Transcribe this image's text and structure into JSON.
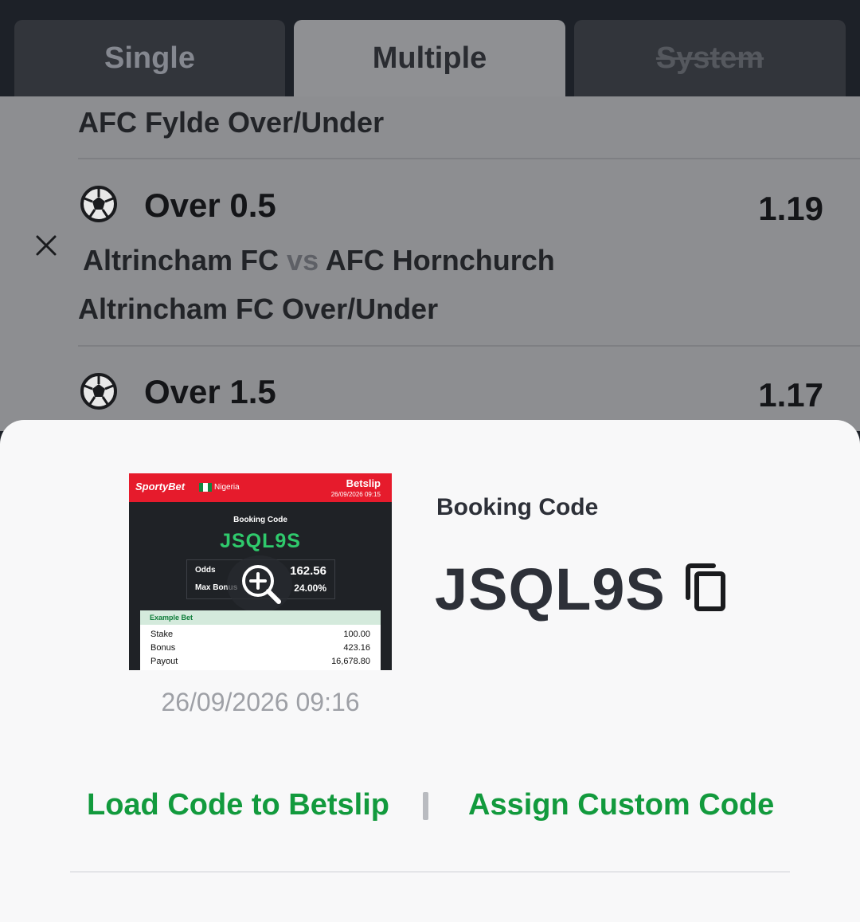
{
  "tabs": [
    {
      "label": "Single",
      "state": "inactive"
    },
    {
      "label": "Multiple",
      "state": "active"
    },
    {
      "label": "System",
      "state": "disabled"
    }
  ],
  "betslip": {
    "partial_market": "AFC Fylde Over/Under",
    "selections": [
      {
        "pick": "Over 0.5",
        "odds": "1.19",
        "home_team": "Altrincham FC",
        "vs": "vs",
        "away_team": "AFC Hornchurch",
        "market": "Altrincham FC Over/Under",
        "sport_icon": "football-icon",
        "remove_icon": "close-icon"
      },
      {
        "pick": "Over 1.5",
        "odds": "1.17",
        "sport_icon": "football-icon"
      }
    ]
  },
  "share_sheet": {
    "thumbnail": {
      "brand": "SportyBet",
      "country": "Nigeria",
      "title": "Betslip",
      "date": "26/09/2026 09:15",
      "booking_label": "Booking Code",
      "booking_code": "JSQL9S",
      "odds_label": "Odds",
      "odds_value": "162.56",
      "max_bonus_label": "Max Bonus",
      "max_bonus_value": "24.00%",
      "example_label": "Example Bet",
      "example_rows": [
        {
          "label": "Stake",
          "value": "100.00"
        },
        {
          "label": "Bonus",
          "value": "423.16"
        },
        {
          "label": "Payout",
          "value": "16,678.80"
        }
      ],
      "zoom_icon": "zoom-in-icon"
    },
    "timestamp": "26/09/2026 09:16",
    "booking_code_label": "Booking Code",
    "booking_code": "JSQL9S",
    "copy_icon": "copy-icon",
    "load_link": "Load Code to Betslip",
    "separator": "|",
    "assign_link": "Assign Custom Code"
  },
  "colors": {
    "accent_green": "#129a3d",
    "code_green": "#2fca6c",
    "brand_red": "#e61b2c",
    "dark_bg": "#1d2128"
  }
}
